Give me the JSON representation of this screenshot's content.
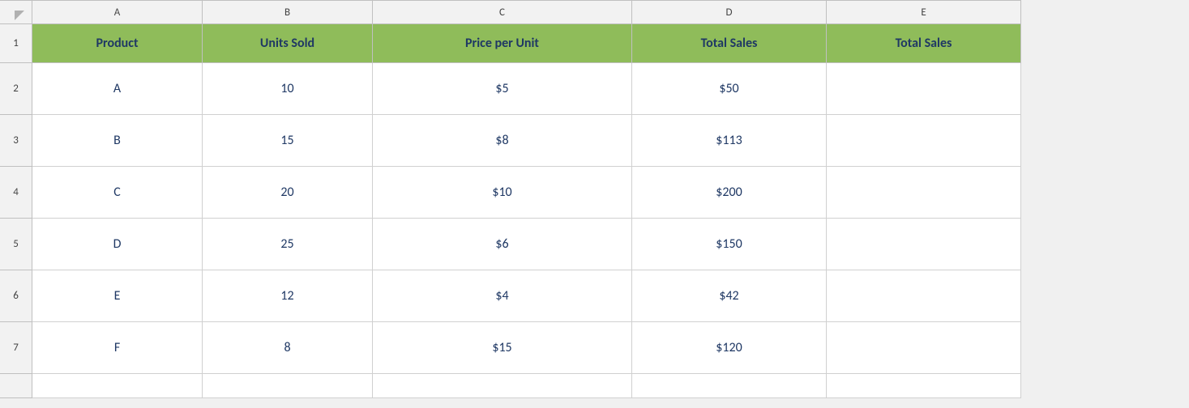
{
  "colHeaders": [
    "A",
    "B",
    "C",
    "D",
    "E"
  ],
  "rowNumbers": [
    "1",
    "2",
    "3",
    "4",
    "5",
    "6",
    "7"
  ],
  "headers": {
    "a": "Product",
    "b": "Units Sold",
    "c": "Price per Unit",
    "d": "Total Sales",
    "e": "Total Sales"
  },
  "rows": [
    {
      "rowNum": "2",
      "a": "A",
      "b": "10",
      "c": "$5",
      "d": "$50",
      "e": ""
    },
    {
      "rowNum": "3",
      "a": "B",
      "b": "15",
      "c": "$8",
      "d": "$113",
      "e": ""
    },
    {
      "rowNum": "4",
      "a": "C",
      "b": "20",
      "c": "$10",
      "d": "$200",
      "e": ""
    },
    {
      "rowNum": "5",
      "a": "D",
      "b": "25",
      "c": "$6",
      "d": "$150",
      "e": ""
    },
    {
      "rowNum": "6",
      "a": "E",
      "b": "12",
      "c": "$4",
      "d": "$42",
      "e": ""
    },
    {
      "rowNum": "7",
      "a": "F",
      "b": "8",
      "c": "$15",
      "d": "$120",
      "e": ""
    }
  ]
}
